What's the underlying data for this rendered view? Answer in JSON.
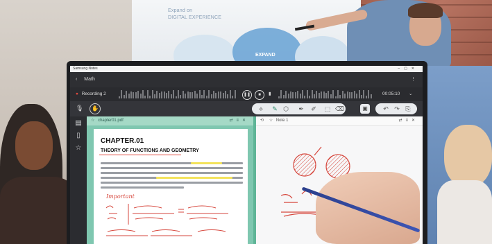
{
  "whiteboard": {
    "line1": "Expand on",
    "line2": "DIGITAL EXPERIENCE",
    "bubble_label": "EXPAND"
  },
  "app": {
    "window_title": "Samsung Notes",
    "notebook": "Math",
    "recording_label": "Recording 2",
    "recording_time": "00:05:10"
  },
  "left_pane": {
    "file_name": "chapter01.pdf",
    "chapter": "CHAPTER.01",
    "heading": "THEORY OF FUNCTIONS AND GEOMETRY",
    "note": "Important"
  },
  "right_pane": {
    "note_name": "Note 1"
  },
  "colors": {
    "accent_green": "#7fc7b0",
    "ink_red": "#d6463c",
    "highlight": "#f3e35c"
  }
}
